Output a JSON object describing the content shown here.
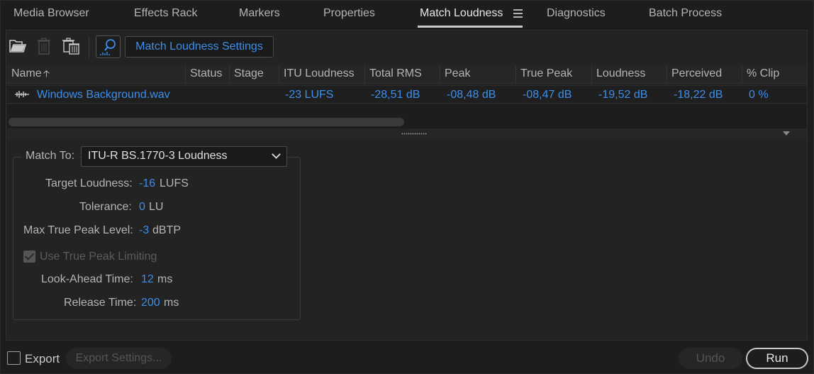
{
  "tabs": [
    {
      "label": "Media Browser"
    },
    {
      "label": "Effects Rack"
    },
    {
      "label": "Markers"
    },
    {
      "label": "Properties"
    },
    {
      "label": "Match Loudness",
      "active": true
    },
    {
      "label": "Diagnostics"
    },
    {
      "label": "Batch Process"
    }
  ],
  "toolbar": {
    "settings_label": "Match Loudness Settings",
    "icons": [
      "open-folder-icon",
      "trash-icon",
      "clear-all-icon",
      "analyze-loudness-icon"
    ]
  },
  "table": {
    "columns": [
      "Name",
      "Status",
      "Stage",
      "ITU Loudness",
      "Total RMS",
      "Peak",
      "True Peak",
      "Loudness",
      "Perceived",
      "% Clip"
    ],
    "rows": [
      {
        "name": "Windows Background.wav",
        "status": "",
        "stage": "",
        "itu_loudness": "-23 LUFS",
        "total_rms": "-28,51 dB",
        "peak": "-08,48 dB",
        "true_peak": "-08,47 dB",
        "loudness": "-19,52 dB",
        "perceived": "-18,22 dB",
        "clip": "0 %"
      }
    ]
  },
  "settings": {
    "match_to_label": "Match To:",
    "match_to_value": "ITU-R BS.1770-3 Loudness",
    "target_loudness_label": "Target Loudness:",
    "target_loudness_value": "-16",
    "target_loudness_unit": "LUFS",
    "tolerance_label": "Tolerance:",
    "tolerance_value": "0",
    "tolerance_unit": "LU",
    "max_true_peak_label": "Max True Peak Level:",
    "max_true_peak_value": "-3",
    "max_true_peak_unit": "dBTP",
    "true_peak_limiting_label": "Use True Peak Limiting",
    "look_ahead_label": "Look-Ahead Time:",
    "look_ahead_value": "12",
    "look_ahead_unit": "ms",
    "release_label": "Release Time:",
    "release_value": "200",
    "release_unit": "ms"
  },
  "footer": {
    "export_label": "Export",
    "export_settings_label": "Export Settings...",
    "undo_label": "Undo",
    "run_label": "Run"
  },
  "colors": {
    "accent": "#3d8eea",
    "background": "#232323"
  }
}
